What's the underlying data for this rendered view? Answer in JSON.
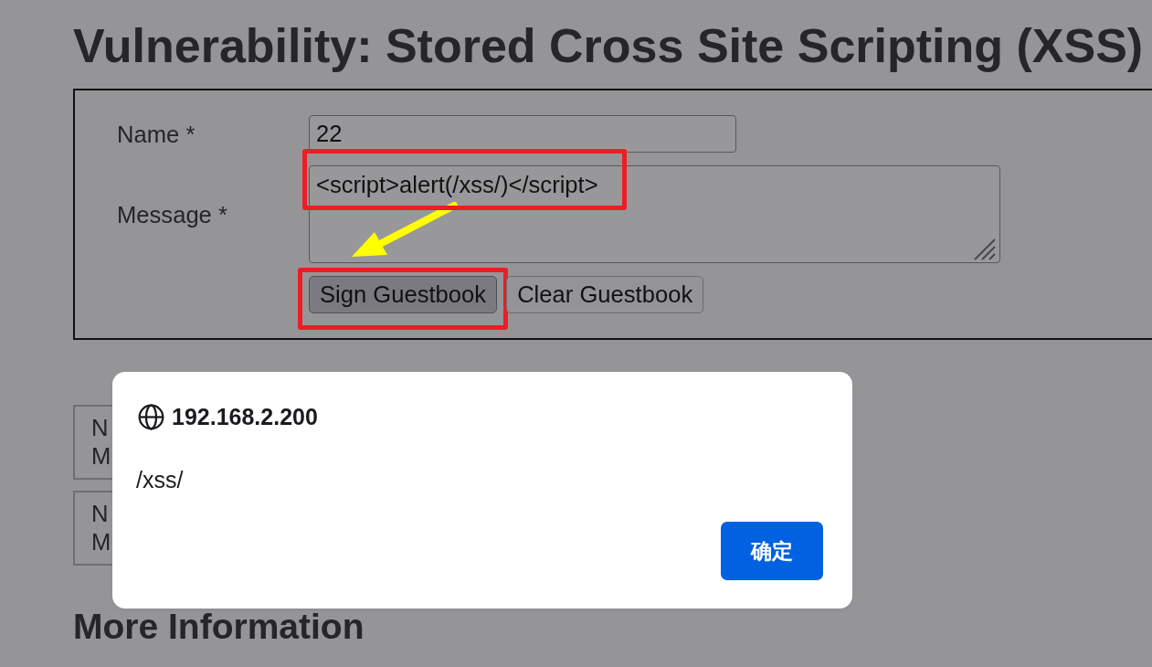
{
  "page": {
    "title": "Vulnerability: Stored Cross Site Scripting (XSS)"
  },
  "form": {
    "fields": [
      {
        "kind": "input",
        "label": "Name *",
        "value": "22",
        "highlighted": false
      },
      {
        "kind": "textarea",
        "label": "Message *",
        "value": "<script>alert(/xss/)</script>",
        "highlighted": true
      }
    ],
    "buttons": [
      {
        "label": "Sign Guestbook",
        "pressed": true,
        "highlighted": true
      },
      {
        "label": "Clear Guestbook",
        "pressed": false,
        "highlighted": false
      }
    ],
    "pointer_arrow": true
  },
  "guestbook_entries": [
    {
      "lines": [
        "N",
        "M"
      ]
    },
    {
      "lines": [
        "N",
        "M"
      ]
    }
  ],
  "more_information": {
    "heading": "More Information"
  },
  "alert_dialog": {
    "origin": "192.168.2.200",
    "message": "/xss/",
    "buttons": [
      {
        "label": "确定"
      }
    ]
  }
}
